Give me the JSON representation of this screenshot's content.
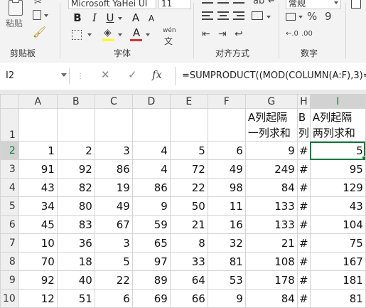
{
  "ribbon": {
    "clipboard": {
      "paste_label": "粘贴",
      "group_label": "剪贴板"
    },
    "font": {
      "font_name": "Microsoft YaHei UI",
      "font_size": "11",
      "bold": "B",
      "italic": "I",
      "underline": "U",
      "font_color_label": "A",
      "size_up": "A",
      "size_down": "A",
      "phonetic": "wén",
      "group_label": "字体"
    },
    "alignment": {
      "group_label": "对齐方式"
    },
    "number": {
      "format": "常规",
      "group_label": "数字"
    },
    "colors": {
      "highlight": "#ffff00",
      "font_color": "#e03030",
      "accent": "#107c41"
    }
  },
  "formula_bar": {
    "name_box": "I2",
    "cancel": "✕",
    "enter": "✓",
    "fx": "fx",
    "formula": "=SUMPRODUCT((MOD(COLUMN(A:F),3)=1)"
  },
  "sheet": {
    "columns": [
      "A",
      "B",
      "C",
      "D",
      "E",
      "F",
      "G",
      "H",
      "I"
    ],
    "header_row": {
      "row": "1",
      "G_line1": "A列起隔",
      "G_line2": "一列求和",
      "H_line1": "B",
      "H_line2": "列",
      "I_line1": "A列起隔",
      "I_line2": "两列求和"
    },
    "rows": [
      {
        "row": "2",
        "cells": [
          "1",
          "2",
          "3",
          "4",
          "5",
          "6",
          "9",
          "#",
          "5"
        ]
      },
      {
        "row": "3",
        "cells": [
          "91",
          "92",
          "86",
          "4",
          "72",
          "49",
          "249",
          "#",
          "95"
        ]
      },
      {
        "row": "4",
        "cells": [
          "43",
          "82",
          "19",
          "86",
          "22",
          "98",
          "84",
          "#",
          "129"
        ]
      },
      {
        "row": "5",
        "cells": [
          "34",
          "80",
          "49",
          "9",
          "50",
          "11",
          "133",
          "#",
          "43"
        ]
      },
      {
        "row": "6",
        "cells": [
          "45",
          "83",
          "67",
          "59",
          "21",
          "16",
          "133",
          "#",
          "104"
        ]
      },
      {
        "row": "7",
        "cells": [
          "10",
          "36",
          "3",
          "65",
          "8",
          "32",
          "21",
          "#",
          "75"
        ]
      },
      {
        "row": "8",
        "cells": [
          "70",
          "18",
          "5",
          "97",
          "33",
          "81",
          "108",
          "#",
          "167"
        ]
      },
      {
        "row": "9",
        "cells": [
          "92",
          "40",
          "22",
          "89",
          "64",
          "53",
          "178",
          "#",
          "181"
        ]
      },
      {
        "row": "10",
        "cells": [
          "12",
          "51",
          "6",
          "69",
          "66",
          "9",
          "84",
          "#",
          "81"
        ]
      }
    ]
  }
}
